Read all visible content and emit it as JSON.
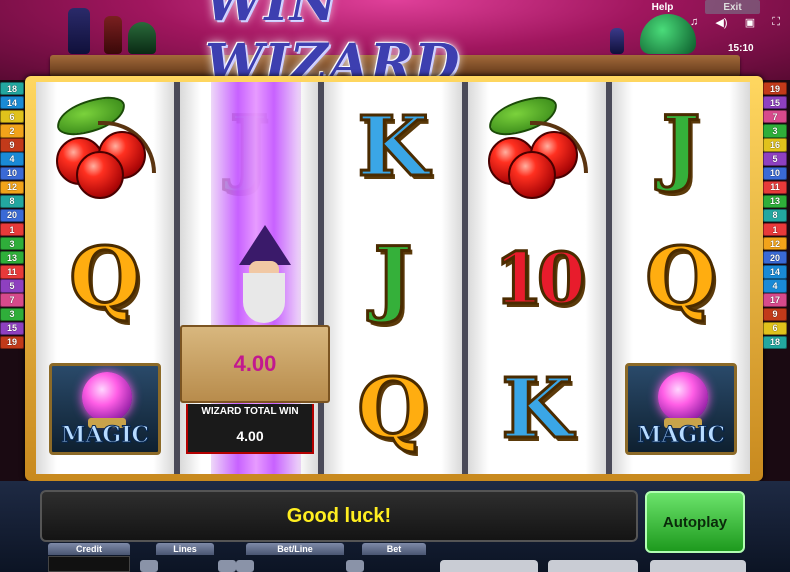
{
  "header": {
    "logo_text": "WIN WIZARD",
    "help_label": "Help",
    "exit_label": "Exit",
    "clock": "15:10",
    "icons": [
      "music-icon",
      "sound-icon",
      "settings-icon",
      "fullscreen-icon"
    ]
  },
  "paylines": {
    "left": [
      "18",
      "14",
      "6",
      "2",
      "9",
      "4",
      "10",
      "12",
      "8",
      "20",
      "1",
      "3",
      "13",
      "11",
      "5",
      "7",
      "3",
      "15",
      "19"
    ],
    "right": [
      "19",
      "15",
      "7",
      "3",
      "16",
      "5",
      "10",
      "11",
      "13",
      "8",
      "1",
      "12",
      "20",
      "14",
      "4",
      "17",
      "9",
      "6",
      "18"
    ],
    "colors": [
      "#e83a3a",
      "#f2a31a",
      "#2fae3a",
      "#1a8ad6",
      "#8e40c0",
      "#e0c21c",
      "#d74a8c",
      "#23a7a0",
      "#c23a1a",
      "#3a6ad6",
      "#e83a3a",
      "#f2a31a",
      "#2fae3a",
      "#1a8ad6",
      "#8e40c0",
      "#e0c21c",
      "#d74a8c",
      "#23a7a0",
      "#c23a1a",
      "#3a6ad6"
    ]
  },
  "reels": [
    [
      "cherry",
      "Q",
      "magic"
    ],
    [
      "J",
      "magic",
      "wizard"
    ],
    [
      "K",
      "J",
      "Q"
    ],
    [
      "cherry",
      "10",
      "K"
    ],
    [
      "J",
      "Q",
      "magic"
    ]
  ],
  "symbols": {
    "magic_label": "MAGIC"
  },
  "wizard_feature": {
    "scroll_value": "4.00",
    "total_win_label": "WIZARD TOTAL WIN",
    "total_win_value": "4.00"
  },
  "bottom": {
    "message": "Good luck!",
    "autoplay_label": "Autoplay",
    "credit_label": "Credit",
    "lines_label": "Lines",
    "bet_line_label": "Bet/Line",
    "bet_label": "Bet"
  }
}
